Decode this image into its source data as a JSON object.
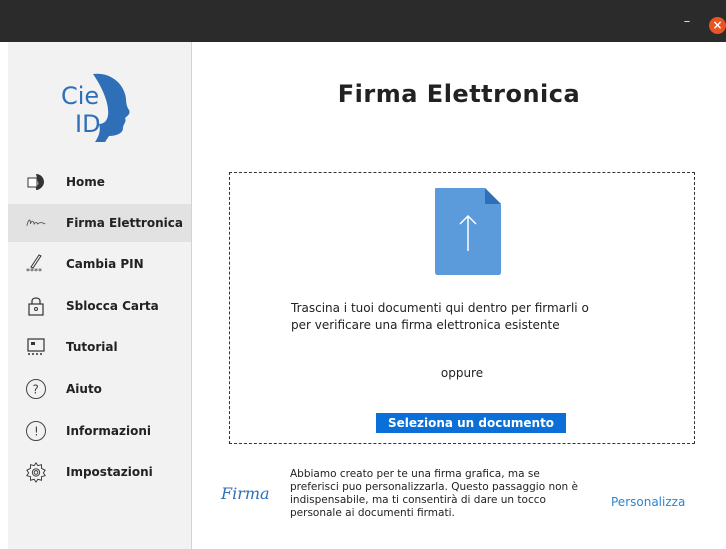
{
  "window": {
    "minimize_glyph": "–",
    "close_glyph": "×"
  },
  "logo": {
    "line1": "Cie",
    "line2": "ID"
  },
  "sidebar": {
    "items": [
      {
        "label": "Home",
        "icon": "cie-id-icon"
      },
      {
        "label": "Firma Elettronica",
        "icon": "signature-icon",
        "active": true
      },
      {
        "label": "Cambia PIN",
        "icon": "pencil-pin-icon"
      },
      {
        "label": "Sblocca Carta",
        "icon": "padlock-icon"
      },
      {
        "label": "Tutorial",
        "icon": "tutorial-icon"
      },
      {
        "label": "Aiuto",
        "icon": "help-icon"
      },
      {
        "label": "Informazioni",
        "icon": "info-icon"
      },
      {
        "label": "Impostazioni",
        "icon": "gear-icon"
      }
    ]
  },
  "main": {
    "title": "Firma Elettronica",
    "drop_text_line1": "Trascina i tuoi documenti qui dentro per firmarli o",
    "drop_text_line2": "per verificare una firma elettronica esistente",
    "or_text": "oppure",
    "select_button": "Seleziona un documento",
    "signature_glyph": "Firma",
    "info_lines": [
      "Abbiamo creato per te una firma grafica, ma se",
      "preferisci puo personalizzarla. Questo passaggio non è",
      "indispensabile, ma ti consentirà di dare un tocco",
      "personale ai documenti firmati."
    ],
    "personalize_link": "Personalizza"
  },
  "colors": {
    "accent": "#0a6fd6",
    "link": "#2a86d1",
    "logo_blue": "#2f6fb8",
    "file_icon": "#5b9bdc",
    "close_button": "#e95420",
    "sidebar_bg": "#f2f2f2"
  }
}
